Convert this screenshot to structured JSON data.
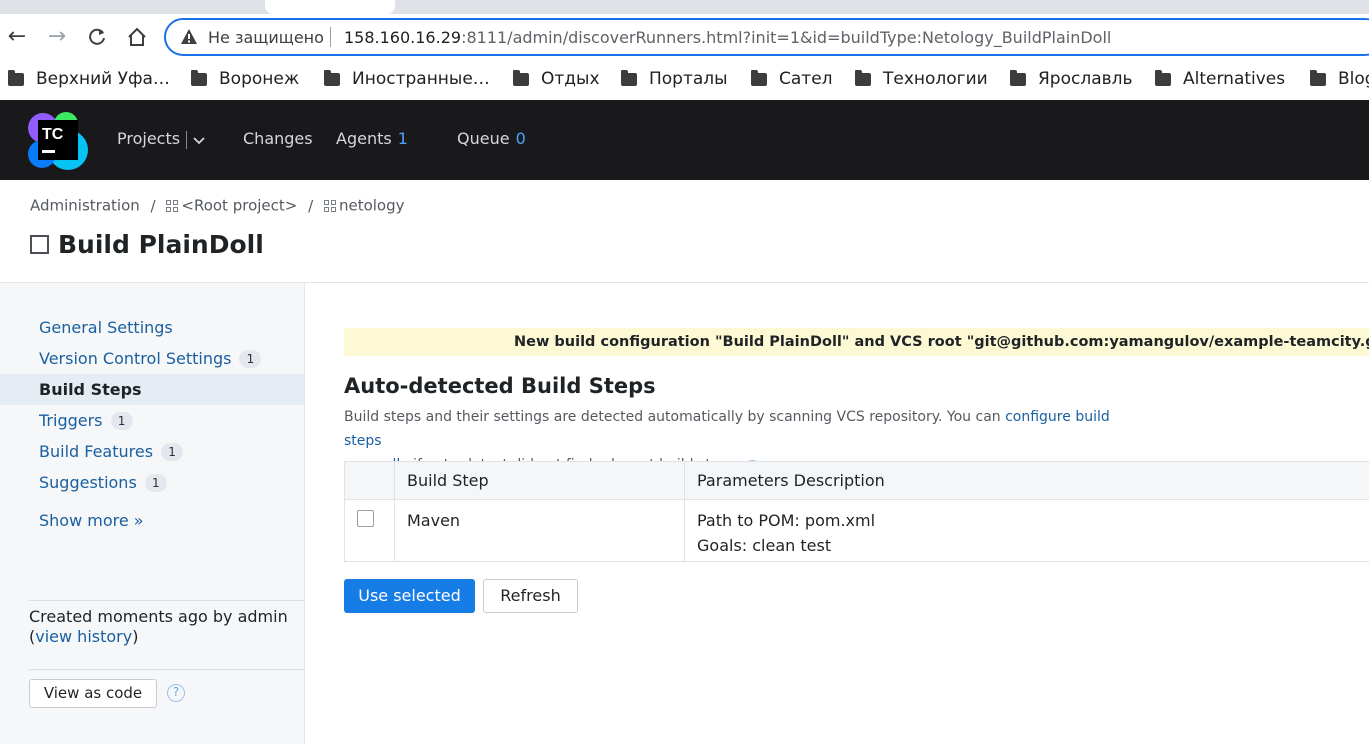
{
  "browser": {
    "insecure_label": "Не защищено",
    "url_host": "158.160.16.29",
    "url_port": ":8111",
    "url_path": "/admin/discoverRunners.html?init=1&id=buildType:Netology_BuildPlainDoll",
    "bookmarks": [
      "Верхний Уфа…",
      "Воронеж",
      "Иностранные…",
      "Отдых",
      "Порталы",
      "Сател",
      "Технологии",
      "Ярославль",
      "Alternatives",
      "Blog"
    ]
  },
  "header": {
    "logo_text": "TC",
    "nav": {
      "projects": "Projects",
      "changes": "Changes",
      "agents": "Agents",
      "agents_count": "1",
      "queue": "Queue",
      "queue_count": "0"
    }
  },
  "breadcrumb": {
    "admin": "Administration",
    "sep": "/",
    "root": "<Root project>",
    "project": "netology"
  },
  "page_title": "Build PlainDoll",
  "sidebar": {
    "items": [
      {
        "label": "General Settings",
        "badge": ""
      },
      {
        "label": "Version Control Settings",
        "badge": "1"
      },
      {
        "label": "Build Steps",
        "badge": ""
      },
      {
        "label": "Triggers",
        "badge": "1"
      },
      {
        "label": "Build Features",
        "badge": "1"
      },
      {
        "label": "Suggestions",
        "badge": "1"
      }
    ],
    "show_more": "Show more »",
    "created_text": "Created moments ago by admin",
    "view_history": "view history",
    "view_as_code": "View as code"
  },
  "main": {
    "notice": "New build configuration \"Build PlainDoll\" and VCS root \"git@github.com:yamangulov/example-teamcity.git#refs/heads/master\" have been created.",
    "heading": "Auto-detected Build Steps",
    "desc_text": "Build steps and their settings are detected automatically by scanning VCS repository. You can ",
    "desc_link1": "configure build steps",
    "desc_link2": "manually",
    "desc_text2": " if auto-detect did not find relevant build steps.",
    "table": {
      "headers": [
        "",
        "Build Step",
        "Parameters Description"
      ],
      "rows": [
        {
          "step": "Maven",
          "param1": "Path to POM: pom.xml",
          "param2": "Goals: clean test"
        }
      ]
    },
    "use_selected": "Use selected",
    "refresh": "Refresh"
  }
}
